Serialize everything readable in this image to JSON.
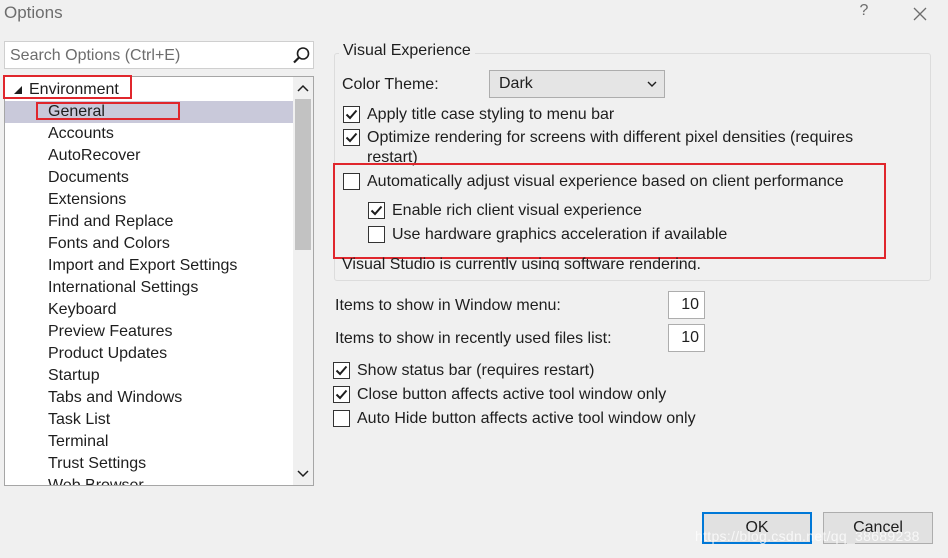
{
  "window": {
    "title": "Options",
    "help_label": "?"
  },
  "search": {
    "placeholder": "Search Options (Ctrl+E)",
    "value": ""
  },
  "tree": {
    "root_label": "Environment",
    "items": [
      {
        "label": "General",
        "selected": true
      },
      {
        "label": "Accounts"
      },
      {
        "label": "AutoRecover"
      },
      {
        "label": "Documents"
      },
      {
        "label": "Extensions"
      },
      {
        "label": "Find and Replace"
      },
      {
        "label": "Fonts and Colors"
      },
      {
        "label": "Import and Export Settings"
      },
      {
        "label": "International Settings"
      },
      {
        "label": "Keyboard"
      },
      {
        "label": "Preview Features"
      },
      {
        "label": "Product Updates"
      },
      {
        "label": "Startup"
      },
      {
        "label": "Tabs and Windows"
      },
      {
        "label": "Task List"
      },
      {
        "label": "Terminal"
      },
      {
        "label": "Trust Settings"
      },
      {
        "label": "Web Browser"
      }
    ]
  },
  "visual_experience": {
    "group_title": "Visual Experience",
    "color_theme_label": "Color Theme:",
    "color_theme_value": "Dark",
    "apply_title_case": {
      "label": "Apply title case styling to menu bar",
      "checked": true
    },
    "optimize_rendering": {
      "label_line1": "Optimize rendering for screens with different pixel densities (requires",
      "label_line2": "restart)",
      "checked": true
    },
    "auto_adjust": {
      "label": "Automatically adjust visual experience based on client performance",
      "checked": false
    },
    "enable_rich": {
      "label": "Enable rich client visual experience",
      "checked": true
    },
    "hardware_accel": {
      "label": "Use hardware graphics acceleration if available",
      "checked": false
    },
    "status_text": "Visual Studio is currently using software rendering."
  },
  "window_menu": {
    "label": "Items to show in Window menu:",
    "value": "10"
  },
  "recent_files": {
    "label": "Items to show in recently used files list:",
    "value": "10"
  },
  "options": {
    "show_status_bar": {
      "label": "Show status bar (requires restart)",
      "checked": true
    },
    "close_button": {
      "label": "Close button affects active tool window only",
      "checked": true
    },
    "auto_hide": {
      "label": "Auto Hide button affects active tool window only",
      "checked": false
    }
  },
  "buttons": {
    "ok": "OK",
    "cancel": "Cancel"
  },
  "watermark": "https://blog.csdn.net/qq_38689238",
  "colors": {
    "highlight_red": "#e0262c",
    "selection": "#c9c9da",
    "default_button_border": "#0078d7"
  }
}
